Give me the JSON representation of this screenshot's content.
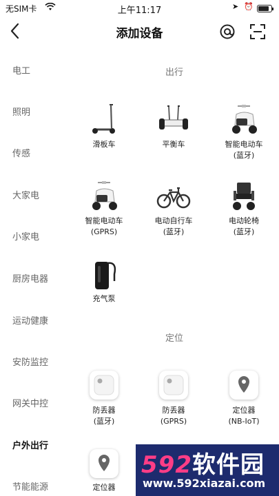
{
  "status_bar": {
    "carrier": "无SIM卡",
    "time": "上午11:17",
    "battery_level": 0.85
  },
  "nav": {
    "title": "添加设备",
    "back_icon": "back-arrow-icon",
    "at_icon": "at-sign-icon",
    "scan_icon": "scan-icon"
  },
  "sidebar": {
    "items": [
      {
        "label": "电工"
      },
      {
        "label": "照明"
      },
      {
        "label": "传感"
      },
      {
        "label": "大家电"
      },
      {
        "label": "小家电"
      },
      {
        "label": "厨房电器"
      },
      {
        "label": "运动健康"
      },
      {
        "label": "安防监控"
      },
      {
        "label": "网关中控"
      },
      {
        "label": "户外出行",
        "active": true
      },
      {
        "label": "节能能源"
      }
    ]
  },
  "sections": [
    {
      "title": "出行",
      "devices": [
        {
          "label1": "滑板车",
          "label2": "",
          "icon": "scooter-icon"
        },
        {
          "label1": "平衡车",
          "label2": "",
          "icon": "balance-board-icon"
        },
        {
          "label1": "智能电动车",
          "label2": "(蓝牙)",
          "icon": "e-moped-icon"
        },
        {
          "label1": "智能电动车",
          "label2": "(GPRS)",
          "icon": "e-moped-icon"
        },
        {
          "label1": "电动自行车",
          "label2": "(蓝牙)",
          "icon": "e-bike-icon"
        },
        {
          "label1": "电动轮椅",
          "label2": "(蓝牙)",
          "icon": "wheelchair-icon"
        },
        {
          "label1": "充气泵",
          "label2": "",
          "icon": "air-pump-icon"
        }
      ]
    },
    {
      "title": "定位",
      "devices": [
        {
          "label1": "防丢器",
          "label2": "(蓝牙)",
          "icon": "tracker-tag-icon"
        },
        {
          "label1": "防丢器",
          "label2": "(GPRS)",
          "icon": "tracker-tag-icon"
        },
        {
          "label1": "定位器",
          "label2": "(NB-IoT)",
          "icon": "location-pin-icon"
        },
        {
          "label1": "定位器",
          "label2": "",
          "icon": "location-pin-icon"
        }
      ]
    }
  ],
  "watermark": {
    "brand": "592",
    "brand_cn": "软件园",
    "url": "www.592xiazai.com"
  },
  "colors": {
    "watermark_bg": "#1d2b6e",
    "watermark_accent": "#ff3d86"
  }
}
